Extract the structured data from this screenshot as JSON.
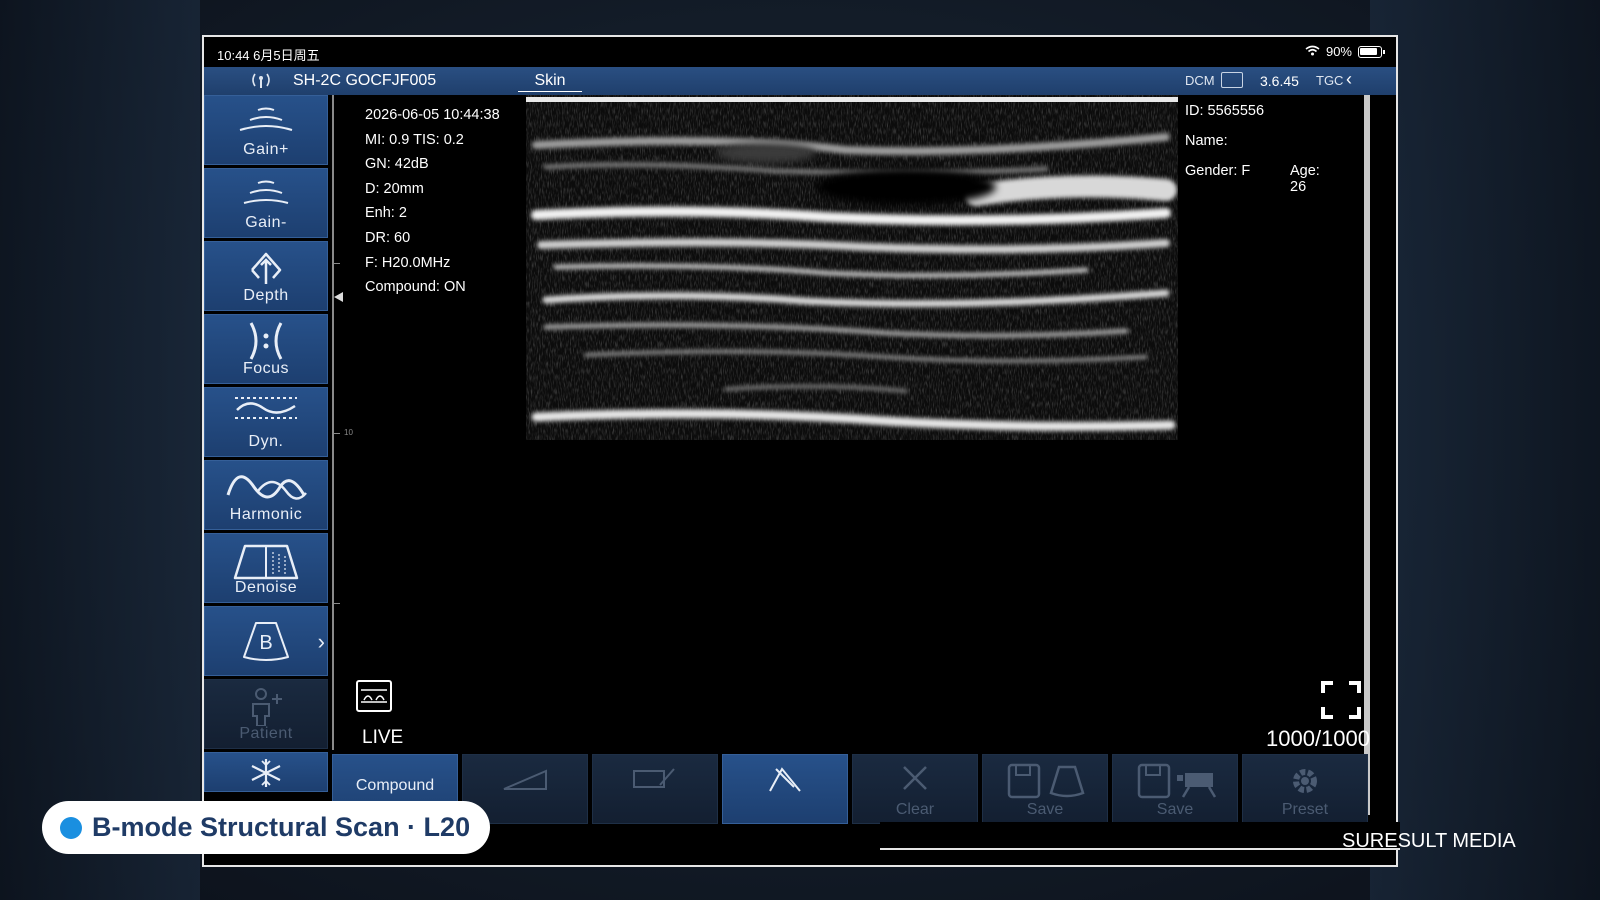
{
  "status_bar": {
    "time": "10:44  6月5日周五",
    "battery": "90%"
  },
  "header": {
    "probe": "SH-2C GOCFJF005",
    "preset": "Skin",
    "dcm": "DCM",
    "version": "3.6.45",
    "tgc": "TGC"
  },
  "left_tools": [
    {
      "label": "Gain+",
      "icon": "gain-up-icon"
    },
    {
      "label": "Gain-",
      "icon": "gain-down-icon"
    },
    {
      "label": "Depth",
      "icon": "depth-icon"
    },
    {
      "label": "Focus",
      "icon": "focus-icon"
    },
    {
      "label": "Dyn.",
      "icon": "dynamic-range-icon"
    },
    {
      "label": "Harmonic",
      "icon": "harmonic-icon"
    },
    {
      "label": "Denoise",
      "icon": "denoise-icon"
    },
    {
      "label": "B",
      "icon": "b-mode-icon"
    },
    {
      "label": "Patient",
      "icon": "patient-icon"
    },
    {
      "label": "",
      "icon": "freeze-icon"
    }
  ],
  "scan_params": {
    "datetime": "2026-06-05 10:44:38",
    "mi_tis": "MI: 0.9  TIS: 0.2",
    "gain": "GN: 42dB",
    "depth": "D: 20mm",
    "enh": "Enh: 2",
    "dr": "DR: 60",
    "freq": "F: H20.0MHz",
    "compound": "Compound: ON"
  },
  "patient": {
    "id": "ID: 5565556",
    "name": "Name:",
    "gender": "Gender: F",
    "age": "Age: 26"
  },
  "scale": {
    "mark_10": "10"
  },
  "live_label": "LIVE",
  "frame_counter": "1000/1000",
  "bottom_tools": [
    {
      "label": "Compound",
      "icon": ""
    },
    {
      "label": "",
      "icon": "measure-icon"
    },
    {
      "label": "",
      "icon": "annotation-icon"
    },
    {
      "label": "",
      "icon": "body-mark-icon"
    },
    {
      "label": "Clear",
      "icon": "clear-icon"
    },
    {
      "label": "Save",
      "icon": "save-image-icon"
    },
    {
      "label": "Save",
      "icon": "save-video-icon"
    },
    {
      "label": "Preset",
      "icon": "preset-gear-icon"
    }
  ],
  "caption": "B-mode Structural Scan · L20",
  "watermark": "SURESULT MEDIA"
}
